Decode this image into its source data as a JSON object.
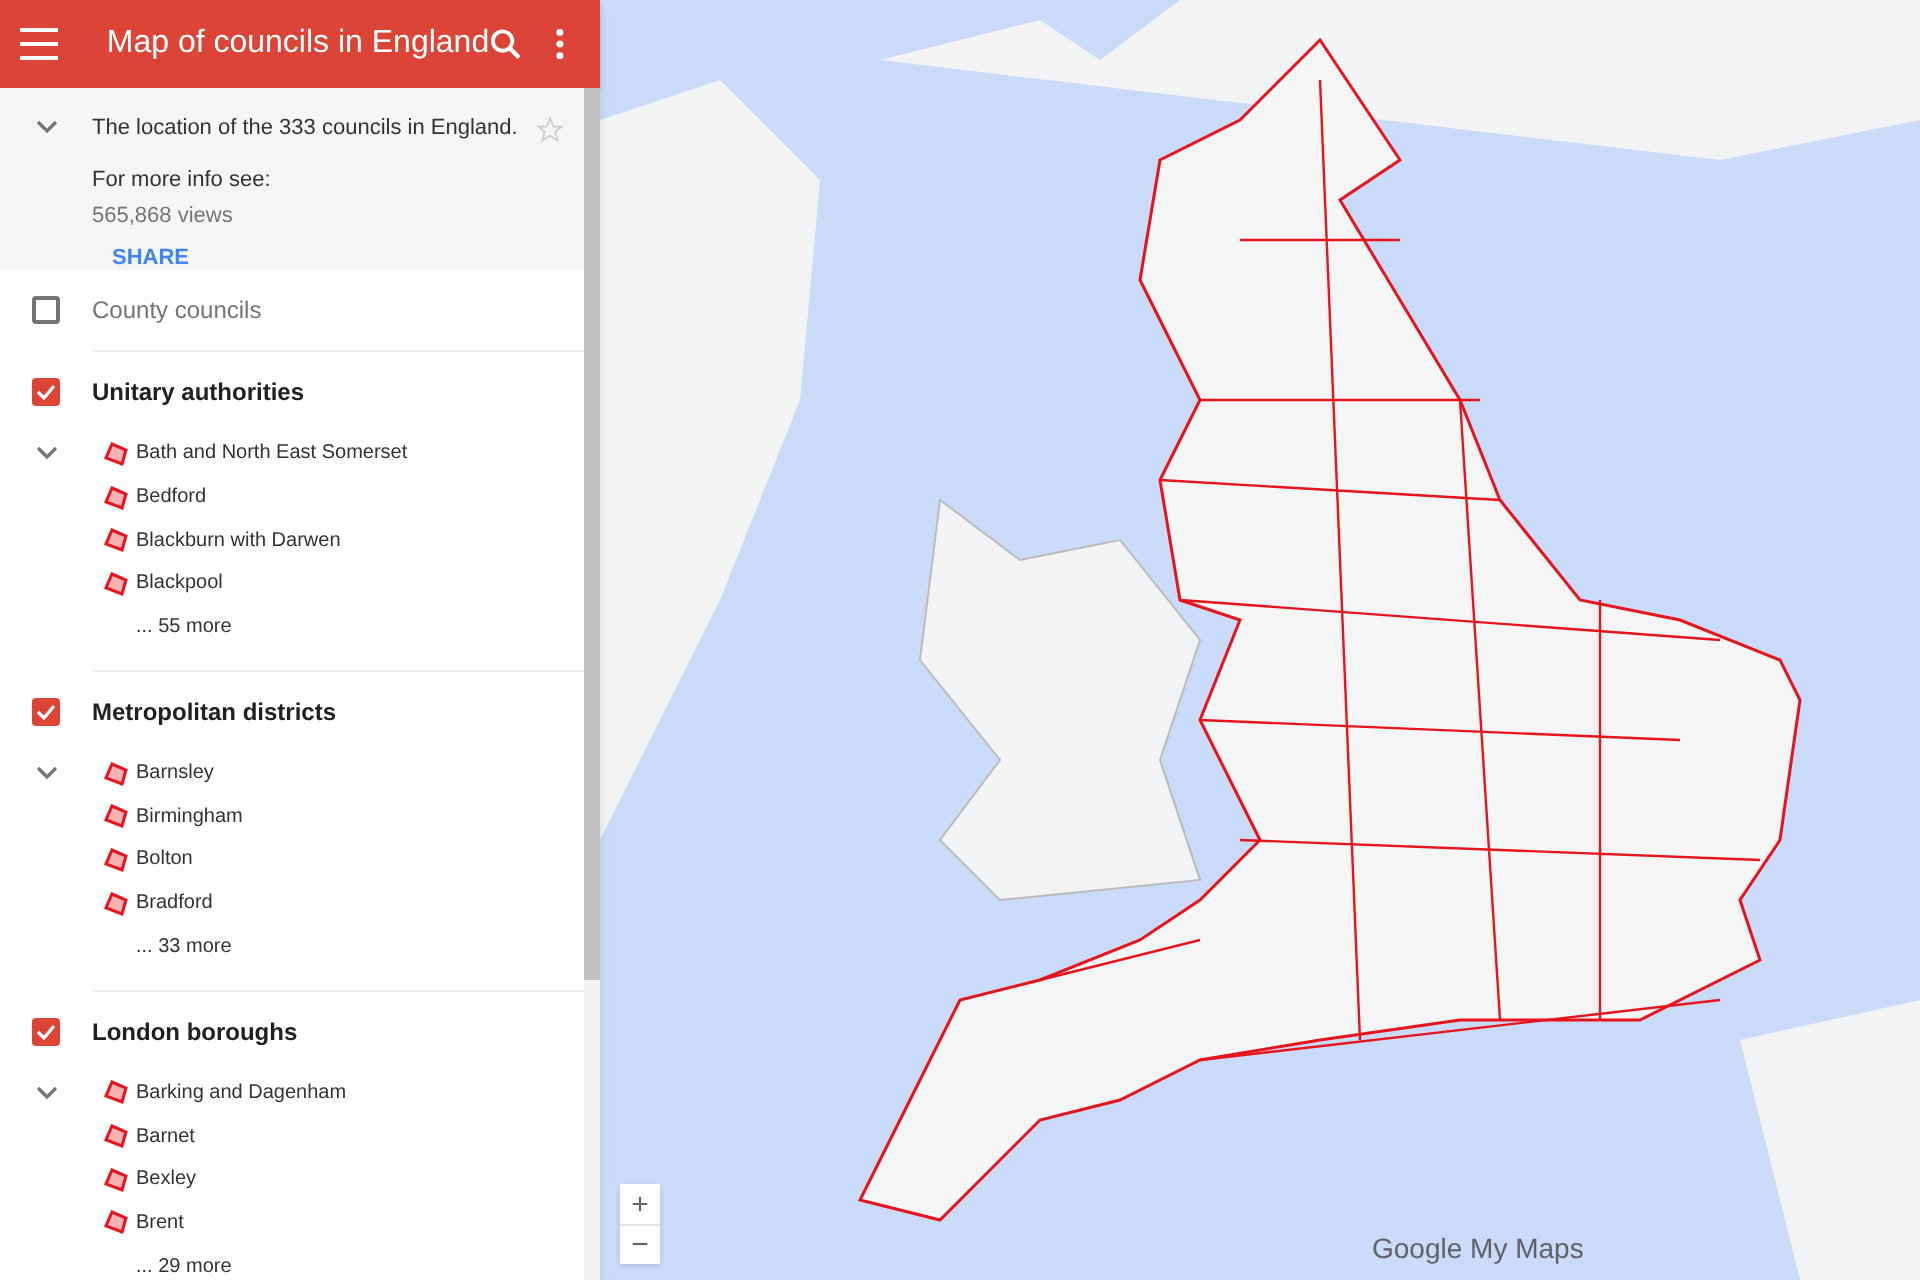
{
  "header": {
    "title": "Map of councils in England"
  },
  "info": {
    "expanded": true,
    "description": "The location of the 333 councils in England.",
    "starred": false,
    "more_info": "For more info see:",
    "views": "565,868 views",
    "share": "SHARE"
  },
  "layers": [
    {
      "title": "County councils",
      "checked": false
    },
    {
      "title": "Unitary authorities",
      "checked": true,
      "expanded": true,
      "items": [
        "Bath and North East Somerset",
        "Bedford",
        "Blackburn with Darwen",
        "Blackpool"
      ],
      "more": "... 55 more"
    },
    {
      "title": "Metropolitan districts",
      "checked": true,
      "expanded": true,
      "items": [
        "Barnsley",
        "Birmingham",
        "Bolton",
        "Bradford"
      ],
      "more": "... 33 more"
    },
    {
      "title": "London boroughs",
      "checked": true,
      "expanded": true,
      "items": [
        "Barking and Dagenham",
        "Barnet",
        "Bexley",
        "Brent"
      ],
      "more": "... 29 more"
    }
  ],
  "map": {
    "zoom_in": "+",
    "zoom_out": "−",
    "attribution": "Google My Maps"
  }
}
